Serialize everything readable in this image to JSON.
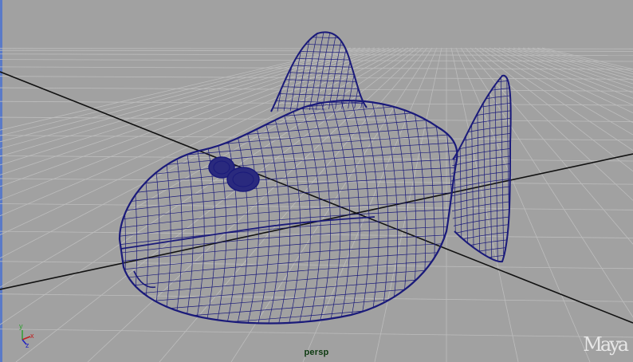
{
  "viewport": {
    "camera_label": "persp",
    "logo_text": "Maya",
    "background_color": "#a1a1a1",
    "wireframe_color": "#1a1a7a",
    "grid_color": "#bdbdbd",
    "axis_line_color": "#111111"
  },
  "axis_gizmo": {
    "y_label": "y",
    "x_label": "x",
    "z_label": "z",
    "y_color": "#2fa02f",
    "x_color": "#c02020",
    "z_color": "#2020c0"
  },
  "scene_object": {
    "name": "fish-mesh",
    "icon": "fish-wireframe"
  }
}
